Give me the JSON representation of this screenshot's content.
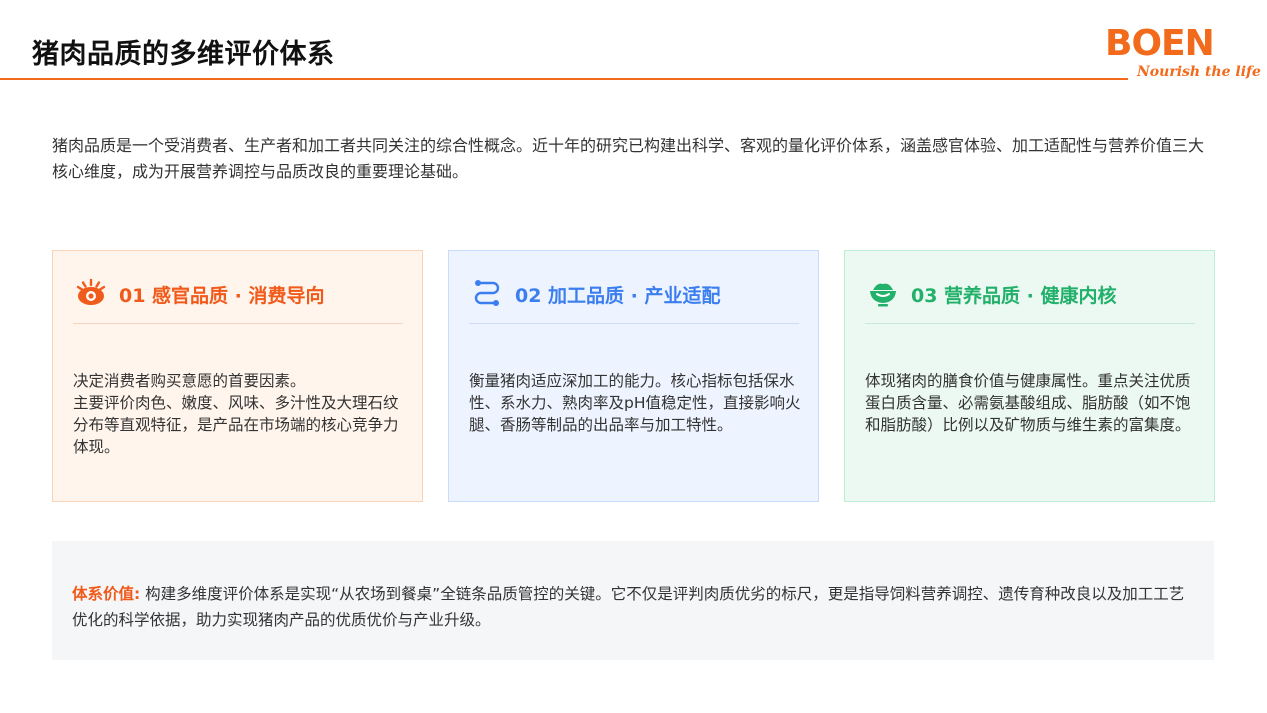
{
  "header": {
    "title": "猪肉品质的多维评价体系",
    "accent_color": "#f26a1b"
  },
  "logo": {
    "wordmark": "BOEN",
    "tagline": "Nourish the life"
  },
  "intro": "猪肉品质是一个受消费者、生产者和加工者共同关注的综合性概念。近十年的研究已构建出科学、客观的量化评价体系，涵盖感官体验、加工适配性与营养价值三大核心维度，成为开展营养调控与品质改良的重要理论基础。",
  "cards": [
    {
      "icon": "eye-icon",
      "title": "01 感官品质 · 消费导向",
      "body": "决定消费者购买意愿的首要因素。\n主要评价肉色、嫩度、风味、多汁性及大理石纹分布等直观特征，是产品在市场端的核心竞争力体现。",
      "color": "#f05a1a"
    },
    {
      "icon": "process-flow-icon",
      "title": "02 加工品质 · 产业适配",
      "body": "衡量猪肉适应深加工的能力。核心指标包括保水性、系水力、熟肉率及pH值稳定性，直接影响火腿、香肠等制品的出品率与加工特性。",
      "color": "#3b7ef0"
    },
    {
      "icon": "bowl-icon",
      "title": "03 营养品质 · 健康内核",
      "body": "体现猪肉的膳食价值与健康属性。重点关注优质蛋白质含量、必需氨基酸组成、脂肪酸（如不饱和脂肪酸）比例以及矿物质与维生素的富集度。",
      "color": "#22b06a"
    }
  ],
  "value": {
    "label": "体系价值:",
    "text": " 构建多维度评价体系是实现“从农场到餐桌”全链条品质管控的关键。它不仅是评判肉质优劣的标尺，更是指导饲料营养调控、遗传育种改良以及加工工艺优化的科学依据，助力实现猪肉产品的优质优价与产业升级。"
  }
}
